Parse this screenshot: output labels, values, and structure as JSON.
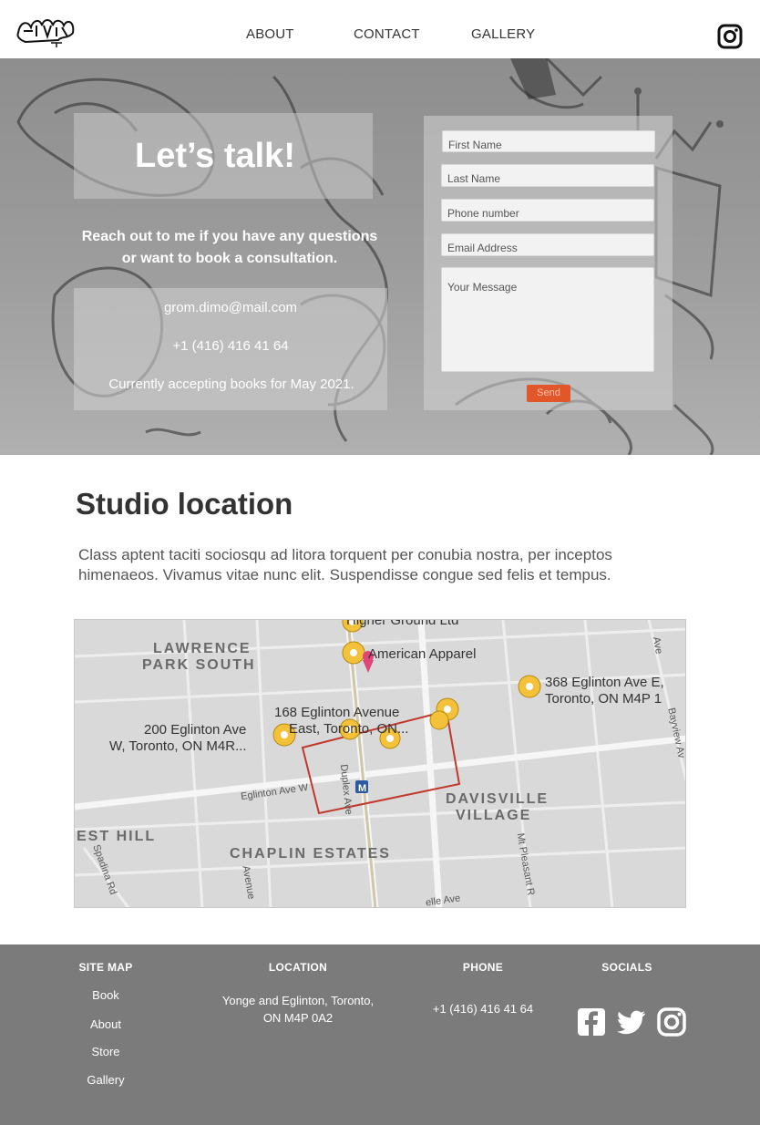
{
  "header": {
    "logo_text": "GROMS",
    "nav": [
      {
        "label": "ABOUT"
      },
      {
        "label": "CONTACT"
      },
      {
        "label": "GALLERY"
      }
    ],
    "instagram_icon": "instagram-icon"
  },
  "hero": {
    "title": "Let’s talk!",
    "subtitle_line1": "Reach out to me if you have any questions",
    "subtitle_line2": "or want to book a consultation.",
    "email": "grom.dimo@mail.com",
    "phone": "+1 (416) 416 41 64",
    "availability": "Currently accepting books for May 2021."
  },
  "form": {
    "first_name_placeholder": "First Name",
    "last_name_placeholder": "Last Name",
    "phone_placeholder": "Phone number",
    "email_placeholder": "Email Address",
    "message_placeholder": "Your Message",
    "send_label": "Send"
  },
  "location": {
    "title": "Studio location",
    "text": "Class aptent taciti sociosqu ad litora torquent per conubia nostra, per inceptos himenaeos. Vivamus vitae nunc elit. Suspendisse congue sed felis et tempus."
  },
  "map": {
    "pins": [
      {
        "label": "Higher Ground Ltd"
      },
      {
        "label": "American Apparel"
      },
      {
        "label": "368 Eglinton Ave E,"
      },
      {
        "label": "Toronto, ON M4P 1"
      },
      {
        "label": "168 Eglinton Avenue"
      },
      {
        "label": "East, Toronto, ON..."
      },
      {
        "label": "200 Eglinton Ave"
      },
      {
        "label": "W, Toronto, ON M4R..."
      }
    ],
    "areas": [
      {
        "label": "LAWRENCE"
      },
      {
        "label": "PARK SOUTH"
      },
      {
        "label": "DAVISVILLE"
      },
      {
        "label": "VILLAGE"
      },
      {
        "label": "EST HILL"
      },
      {
        "label": "CHAPLIN ESTATES"
      }
    ],
    "streets": [
      {
        "label": "Eglinton Ave W"
      },
      {
        "label": "Duplex Ave"
      },
      {
        "label": "Spadina Rd"
      },
      {
        "label": "Avenue"
      },
      {
        "label": "Mt Pleasant R"
      },
      {
        "label": "Bayview Av"
      },
      {
        "label": "Ave"
      },
      {
        "label": "elle Ave"
      }
    ]
  },
  "footer": {
    "site_map_title": "SITE MAP",
    "links": [
      {
        "label": "Book"
      },
      {
        "label": "About"
      },
      {
        "label": "Store"
      },
      {
        "label": "Gallery"
      }
    ],
    "location_title": "LOCATION",
    "address_line1": "Yonge and Eglinton, Toronto,",
    "address_line2": "ON M4P 0A2",
    "phone_title": "PHONE",
    "phone": "+1 (416) 416 41 64",
    "socials_title": "SOCIALS",
    "socials": [
      {
        "icon": "facebook-icon"
      },
      {
        "icon": "twitter-icon"
      },
      {
        "icon": "instagram-icon"
      }
    ]
  },
  "colors": {
    "accent": "#e2572a",
    "footer_bg": "#7b7b7b",
    "text_dark": "#333333",
    "hero_gray": "#9c9c9c"
  }
}
